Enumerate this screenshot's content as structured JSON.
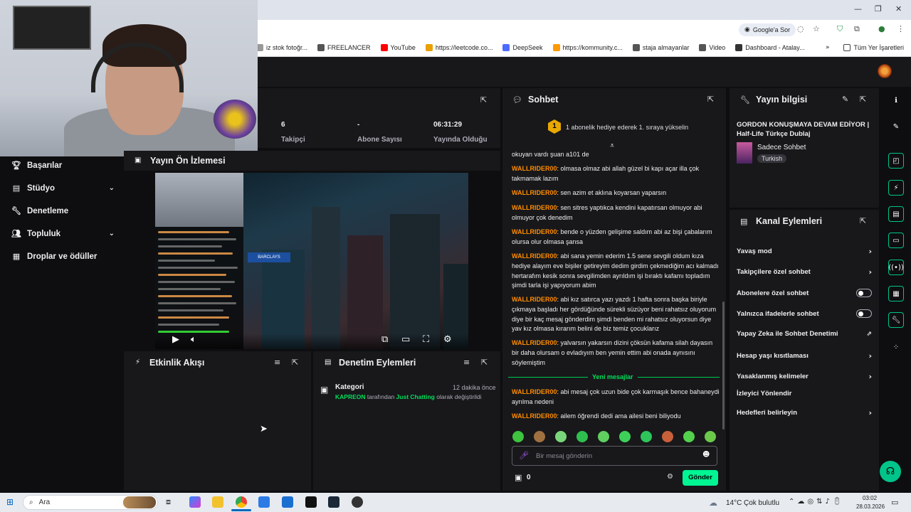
{
  "browser": {
    "google_sor": "Google'a Sor",
    "bookmarks": [
      {
        "label": "iz stok fotoğr...",
        "icon": "bookmark-icon"
      },
      {
        "label": "FREELANCER",
        "icon": "folder-icon"
      },
      {
        "label": "YouTube",
        "icon": "youtube-icon"
      },
      {
        "label": "https://leetcode.co...",
        "icon": "leetcode-icon"
      },
      {
        "label": "DeepSeek",
        "icon": "deepseek-icon"
      },
      {
        "label": "https://kommunity.c...",
        "icon": "kommunity-icon"
      },
      {
        "label": "staja almayanlar",
        "icon": "folder-icon"
      },
      {
        "label": "Video",
        "icon": "folder-icon"
      },
      {
        "label": "Dashboard - Atalay...",
        "icon": "dashboard-icon"
      }
    ],
    "all_bookmarks": "Tüm Yer İşaretleri"
  },
  "sidebar": {
    "items": [
      {
        "label": "Başarılar",
        "icon": "trophy-icon",
        "chevron": false
      },
      {
        "label": "Stüdyo",
        "icon": "film-icon",
        "chevron": true
      },
      {
        "label": "Denetleme",
        "icon": "wrench-icon",
        "chevron": false
      },
      {
        "label": "Topluluk",
        "icon": "people-icon",
        "chevron": true
      },
      {
        "label": "Droplar ve ödüller",
        "icon": "gift-icon",
        "chevron": false
      }
    ]
  },
  "stats": {
    "followers_value": "6",
    "followers_label": "Takipçi",
    "subs_value": "-",
    "subs_label": "Abone Sayısı",
    "uptime_value": "06:31:29",
    "uptime_label": "Yayında Olduğu"
  },
  "preview": {
    "title": "Yayın Ön İzlemesi",
    "bank_sign": "BARCLAYS"
  },
  "activity": {
    "title": "Etkinlik Akışı"
  },
  "mod_actions": {
    "title": "Denetim Eylemleri",
    "entry": {
      "category": "Kategori",
      "time": "12 dakika önce",
      "user": "KAPREON",
      "by": "tarafından",
      "game": "Just Chatting",
      "suffix": "olarak değiştirildi"
    }
  },
  "chat": {
    "title": "Sohbet",
    "hype_text": "1 abonelik hediye ederek 1. sıraya yükselin",
    "hype_rank": "1",
    "partial": "okuyan vardı şuan a101 de",
    "messages": [
      {
        "user": "WALLRIDER00",
        "text": "olmasa olmaz abi allah güzel bi kapı açar illa çok takmamak lazım"
      },
      {
        "user": "WALLRIDER00",
        "text": "sen azim et aklına koyarsan yaparsın"
      },
      {
        "user": "WALLRIDER00",
        "text": "sen sitres yaptıkca kendini kapatırsan olmuyor abi olmuyor çok denedim"
      },
      {
        "user": "WALLRIDER00",
        "text": "bende o yüzden gelişime saldım abi az bişi çabalarım olursa olur olmasa şansa"
      },
      {
        "user": "WALLRIDER00",
        "text": "abi sana yemin ederim 1.5 sene sevgili oldum kıza hediye alayım eve bişiler getireyim dedim girdim çekmediğim acı kalmadı hertarafım kesik sonra sevgilimden ayrıldım işi bıraktı kafamı topladım şimdi tarla işi yapıyorum abim"
      },
      {
        "user": "WALLRIDER00",
        "text": "abi kız satırca yazı yazdı 1 hafta sonra başka biriyle çıkmaya başladı her gördüğünde sürekli süzüyor beni rahatsız oluyorum diye bir kaç mesaj gönderdim şimdi benden mi rahatsız oluyorsun diye yav kız olmasa kırarım belini de biz temiz çocuklarız"
      },
      {
        "user": "WALLRIDER00",
        "text": "yalvarsın yakarsın dizini çöksün kafama silah dayasın bir daha olursam o evladıyım ben yemin ettim abi onada aynısını söylemiştim"
      }
    ],
    "new_messages": "Yeni mesajlar",
    "new": [
      {
        "user": "WALLRIDER00",
        "text": "abi mesaj çok uzun bide çok karmaşık bence bahaneydi ayrılma nedeni"
      },
      {
        "user": "WALLRIDER00",
        "text": "ailem öğrendi dedi ama ailesi beni biliyodu"
      }
    ],
    "input_placeholder": "Bir mesaj gönderin",
    "points": "0",
    "send": "Gönder"
  },
  "stream_info": {
    "title": "Yayın bilgisi",
    "stream_title": "GORDON KONUŞMAYA DEVAM EDİYOR | Half-Life Türkçe Dublaj",
    "category": "Sadece Sohbet",
    "tag": "Turkish"
  },
  "channel_actions": {
    "title": "Kanal Eylemleri",
    "rows": [
      {
        "label": "Yavaş mod",
        "type": "chevron"
      },
      {
        "label": "Takipçilere özel sohbet",
        "type": "chevron"
      },
      {
        "label": "Abonelere özel sohbet",
        "type": "toggle"
      },
      {
        "label": "Yalnızca ifadelerle sohbet",
        "type": "toggle"
      },
      {
        "label": "Yapay Zeka ile Sohbet Denetimi",
        "type": "external"
      },
      {
        "label": "Hesap yaşı kısıtlaması",
        "type": "chevron"
      },
      {
        "label": "Yasaklanmış kelimeler",
        "type": "chevron"
      },
      {
        "label": "İzleyici Yönlendir",
        "type": "none"
      },
      {
        "label": "Hedefleri belirleyin",
        "type": "chevron"
      }
    ]
  },
  "taskbar": {
    "search": "Ara",
    "weather": "14°C",
    "weather_text": "Çok bulutlu",
    "time": "03:02",
    "date": "28.03.2026"
  },
  "colors": {
    "accent_green": "#00e05a",
    "username_orange": "#ff8c00",
    "panel_bg": "#18181b",
    "page_bg": "#0e0e10"
  }
}
